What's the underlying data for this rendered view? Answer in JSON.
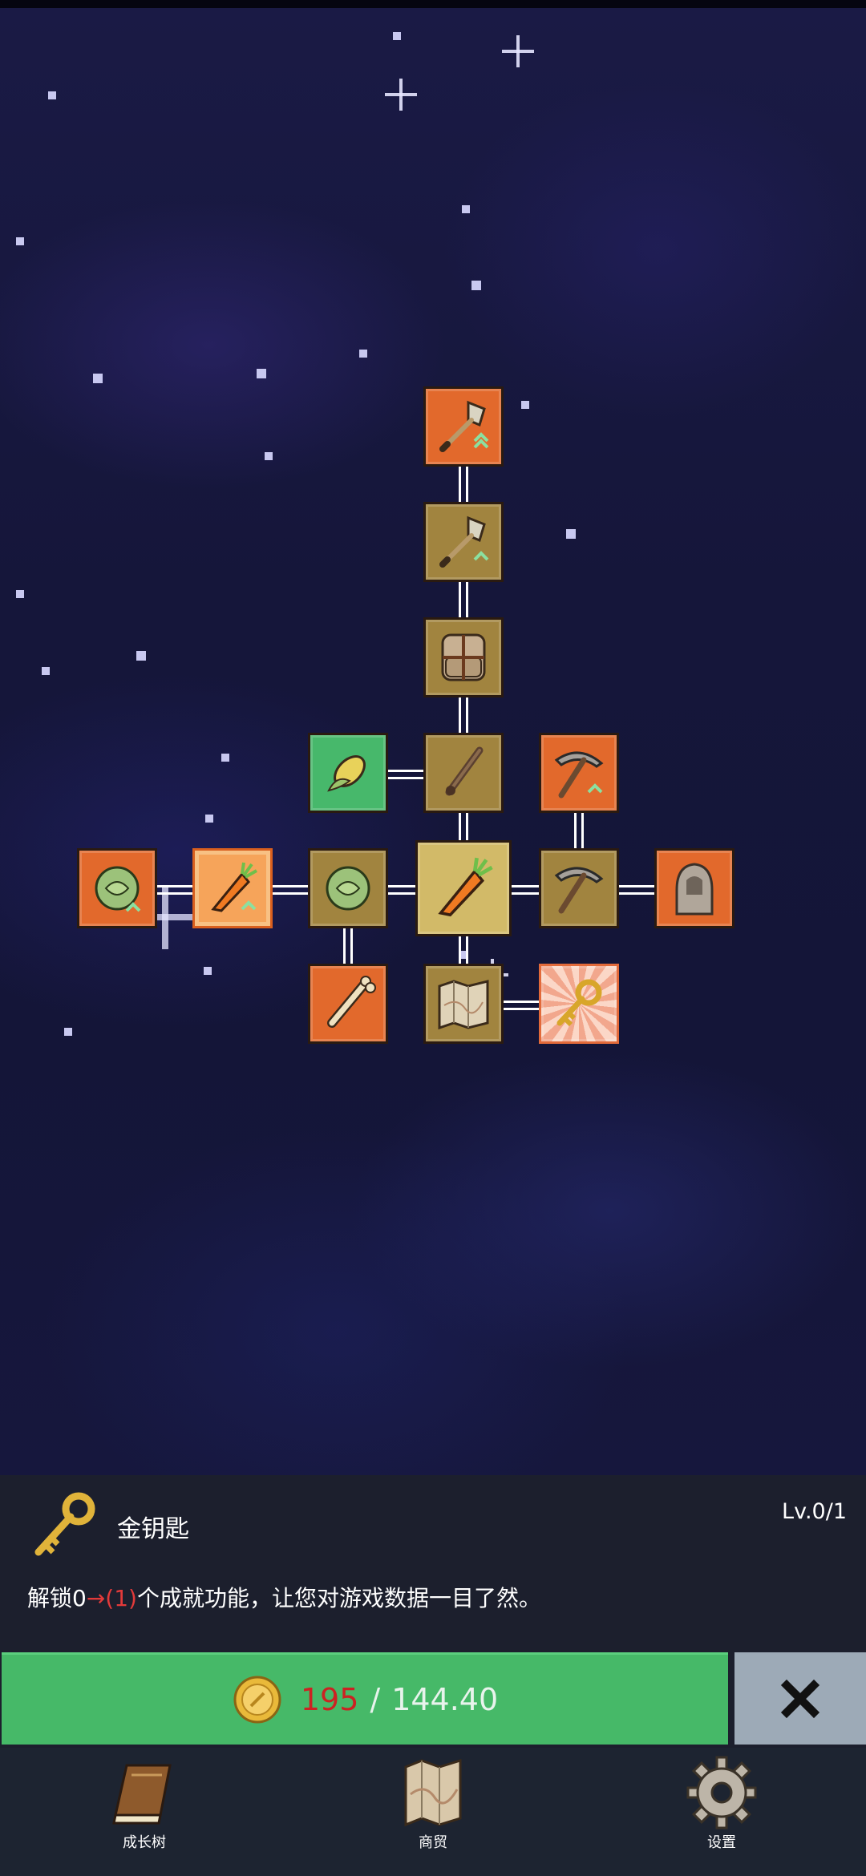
{
  "detail_panel": {
    "item_icon": "golden-key-icon",
    "item_name": "金钥匙",
    "level": "Lv.0/1",
    "description_prefix": "解锁0",
    "description_arrow": "→",
    "description_next": "(1)",
    "description_suffix": "个成就功能，让您对游戏数据一目了然。"
  },
  "purchase": {
    "coin_icon": "gold-coin-icon",
    "cost": "195",
    "separator": "/",
    "balance": "144.40"
  },
  "close_icon": "close-x-icon",
  "bottom_nav": [
    {
      "label": "成长树",
      "icon": "book-icon"
    },
    {
      "label": "商贸",
      "icon": "map-icon"
    },
    {
      "label": "设置",
      "icon": "gear-icon"
    }
  ],
  "skill_tree": [
    {
      "id": "shovel-upgrade",
      "icon": "shovel-up-arrows-icon",
      "color": "#e2692c"
    },
    {
      "id": "shovel",
      "icon": "shovel-up-arrow-icon",
      "color": "#a1843f"
    },
    {
      "id": "backpack",
      "icon": "backpack-icon",
      "color": "#a1843f"
    },
    {
      "id": "corn",
      "icon": "corn-icon",
      "color": "#47b86b"
    },
    {
      "id": "stick",
      "icon": "stick-icon",
      "color": "#a1843f"
    },
    {
      "id": "pickaxe-upgrade",
      "icon": "pickaxe-up-arrow-icon",
      "color": "#e2692c"
    },
    {
      "id": "cabbage-upgrade",
      "icon": "cabbage-up-arrow-icon",
      "color": "#e2692c"
    },
    {
      "id": "carrot-upgrade",
      "icon": "carrot-up-arrow-icon",
      "color": "#f6a45a"
    },
    {
      "id": "cabbage",
      "icon": "cabbage-icon",
      "color": "#a1843f"
    },
    {
      "id": "carrot-root",
      "icon": "carrot-icon",
      "color": "#d2ba68"
    },
    {
      "id": "pickaxe",
      "icon": "pickaxe-icon",
      "color": "#a1843f"
    },
    {
      "id": "statue",
      "icon": "hooded-statue-icon",
      "color": "#e2692c"
    },
    {
      "id": "bone",
      "icon": "bone-icon",
      "color": "#e2692c"
    },
    {
      "id": "map",
      "icon": "map-icon",
      "color": "#a1843f"
    },
    {
      "id": "golden-key",
      "icon": "golden-key-icon",
      "color": "#f2a78d"
    }
  ]
}
